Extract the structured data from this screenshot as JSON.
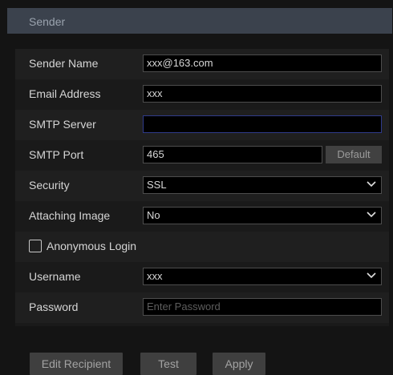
{
  "header": {
    "title": "Sender"
  },
  "form": {
    "sender_name": {
      "label": "Sender Name",
      "value": "xxx@163.com"
    },
    "email_address": {
      "label": "Email Address",
      "value": "xxx"
    },
    "smtp_server": {
      "label": "SMTP Server",
      "value": ""
    },
    "smtp_port": {
      "label": "SMTP Port",
      "value": "465",
      "default_label": "Default"
    },
    "security": {
      "label": "Security",
      "value": "SSL"
    },
    "attaching_image": {
      "label": "Attaching Image",
      "value": "No"
    },
    "anonymous_login": {
      "label": "Anonymous Login",
      "checked": false
    },
    "username": {
      "label": "Username",
      "value": "xxx"
    },
    "password": {
      "label": "Password",
      "placeholder": "Enter Password",
      "value": ""
    }
  },
  "buttons": {
    "edit_recipient": "Edit Recipient",
    "test": "Test",
    "apply": "Apply"
  },
  "colors": {
    "header_bg": "#3b424d",
    "focus_border": "#2f3b8a",
    "button_bg": "#3f3f3f"
  }
}
